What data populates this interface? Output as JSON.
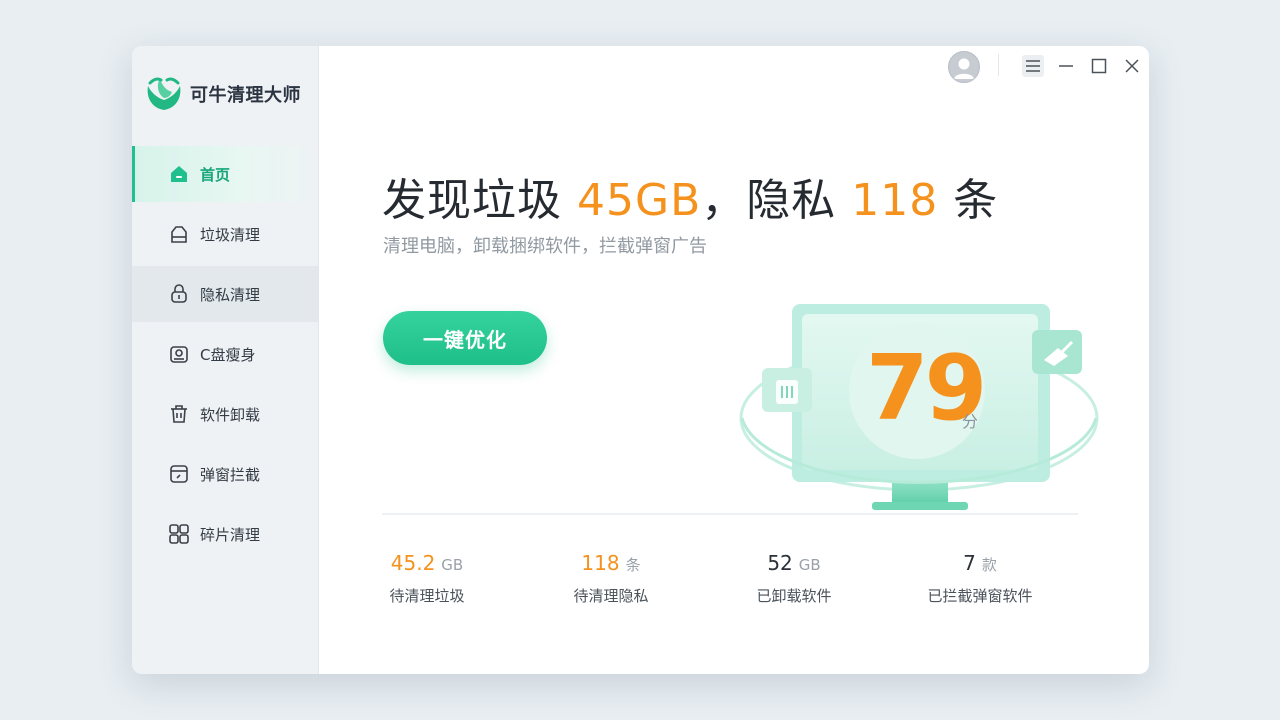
{
  "app": {
    "name": "可牛清理大师"
  },
  "sidebar": {
    "items": [
      {
        "label": "首页",
        "icon": "home-icon"
      },
      {
        "label": "垃圾清理",
        "icon": "trash-clean-icon"
      },
      {
        "label": "隐私清理",
        "icon": "lock-icon"
      },
      {
        "label": "C盘瘦身",
        "icon": "disk-icon"
      },
      {
        "label": "软件卸载",
        "icon": "uninstall-icon"
      },
      {
        "label": "弹窗拦截",
        "icon": "popup-block-icon"
      },
      {
        "label": "碎片清理",
        "icon": "fragments-icon"
      }
    ]
  },
  "main": {
    "headline": {
      "part1": "发现垃圾 ",
      "junk_value": "45GB",
      "part2": "，隐私 ",
      "privacy_value": "118",
      "part3": " 条"
    },
    "subtitle": "清理电脑，卸载捆绑软件，拦截弹窗广告",
    "optimize_button": "一键优化",
    "score": "79",
    "score_unit": "分"
  },
  "stats": [
    {
      "value": "45.2",
      "unit": "GB",
      "label": "待清理垃圾"
    },
    {
      "value": "118",
      "unit": "条",
      "label": "待清理隐私"
    },
    {
      "value": "52",
      "unit": "GB",
      "label": "已卸载软件"
    },
    {
      "value": "7",
      "unit": "款",
      "label": "已拦截弹窗软件"
    }
  ],
  "colors": {
    "accent": "#1fbf8e",
    "highlight": "#f5921e"
  }
}
